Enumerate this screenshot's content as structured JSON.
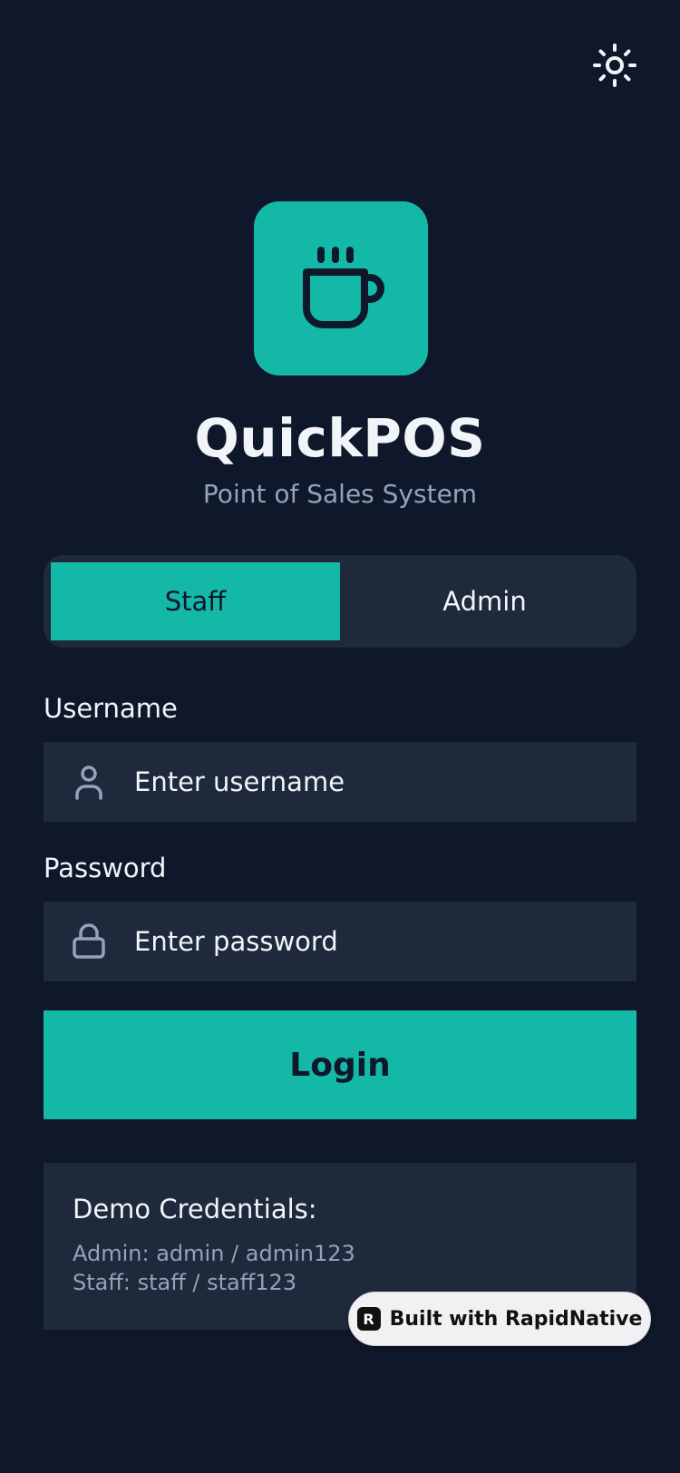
{
  "header": {
    "theme_icon": "sun-icon"
  },
  "brand": {
    "logo_icon": "coffee-cup-icon",
    "title": "QuickPOS",
    "subtitle": "Point of Sales System",
    "accent_color": "#14b8a6"
  },
  "role_switch": {
    "tabs": [
      {
        "label": "Staff",
        "active": true
      },
      {
        "label": "Admin",
        "active": false
      }
    ]
  },
  "form": {
    "username": {
      "label": "Username",
      "placeholder": "Enter username",
      "icon": "user-icon"
    },
    "password": {
      "label": "Password",
      "placeholder": "Enter password",
      "icon": "lock-icon"
    },
    "login_label": "Login"
  },
  "demo": {
    "title": "Demo Credentials:",
    "lines": [
      "Admin: admin / admin123",
      "Staff: staff / staff123"
    ]
  },
  "badge": {
    "text": "Built with RapidNative",
    "logo_glyph": "R"
  }
}
